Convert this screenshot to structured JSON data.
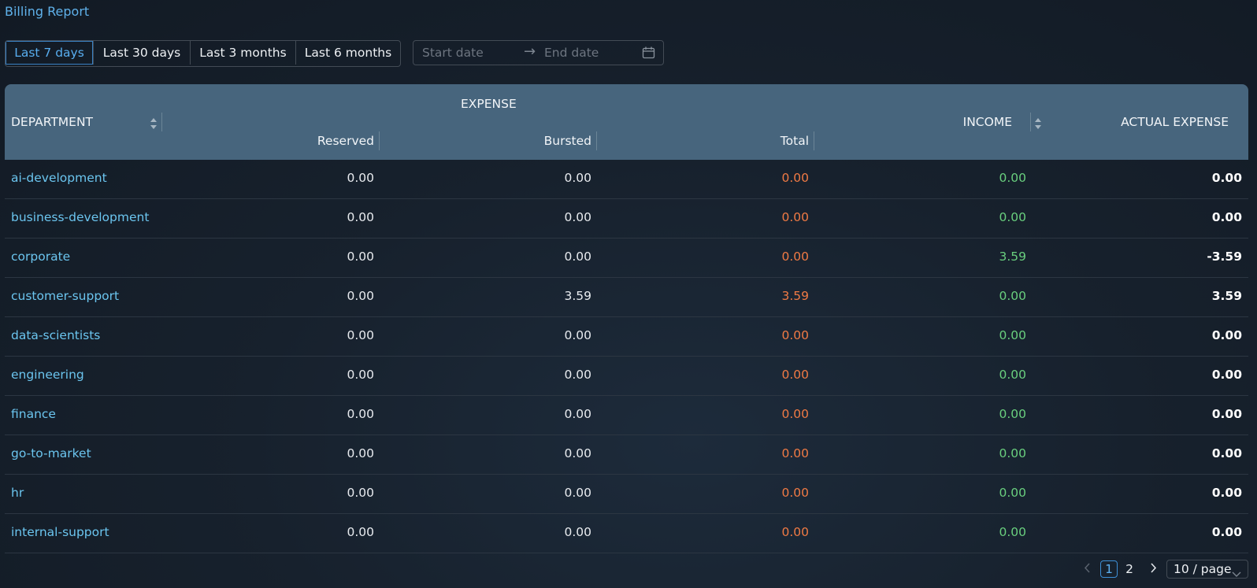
{
  "page": {
    "title": "Billing Report"
  },
  "ranges": [
    {
      "label": "Last 7 days",
      "active": true
    },
    {
      "label": "Last 30 days",
      "active": false
    },
    {
      "label": "Last 3 months",
      "active": false
    },
    {
      "label": "Last 6 months",
      "active": false
    }
  ],
  "date_picker": {
    "start_placeholder": "Start date",
    "end_placeholder": "End date",
    "separator": "→",
    "icon": "calendar-icon"
  },
  "table": {
    "headers": {
      "department": "DEPARTMENT",
      "expense": "EXPENSE",
      "reserved": "Reserved",
      "bursted": "Bursted",
      "total": "Total",
      "income": "INCOME",
      "actual_expense": "ACTUAL EXPENSE"
    },
    "rows": [
      {
        "department": "ai-development",
        "reserved": "0.00",
        "bursted": "0.00",
        "total": "0.00",
        "income": "0.00",
        "actual": "0.00"
      },
      {
        "department": "business-development",
        "reserved": "0.00",
        "bursted": "0.00",
        "total": "0.00",
        "income": "0.00",
        "actual": "0.00"
      },
      {
        "department": "corporate",
        "reserved": "0.00",
        "bursted": "0.00",
        "total": "0.00",
        "income": "3.59",
        "actual": "-3.59"
      },
      {
        "department": "customer-support",
        "reserved": "0.00",
        "bursted": "3.59",
        "total": "3.59",
        "income": "0.00",
        "actual": "3.59"
      },
      {
        "department": "data-scientists",
        "reserved": "0.00",
        "bursted": "0.00",
        "total": "0.00",
        "income": "0.00",
        "actual": "0.00"
      },
      {
        "department": "engineering",
        "reserved": "0.00",
        "bursted": "0.00",
        "total": "0.00",
        "income": "0.00",
        "actual": "0.00"
      },
      {
        "department": "finance",
        "reserved": "0.00",
        "bursted": "0.00",
        "total": "0.00",
        "income": "0.00",
        "actual": "0.00"
      },
      {
        "department": "go-to-market",
        "reserved": "0.00",
        "bursted": "0.00",
        "total": "0.00",
        "income": "0.00",
        "actual": "0.00"
      },
      {
        "department": "hr",
        "reserved": "0.00",
        "bursted": "0.00",
        "total": "0.00",
        "income": "0.00",
        "actual": "0.00"
      },
      {
        "department": "internal-support",
        "reserved": "0.00",
        "bursted": "0.00",
        "total": "0.00",
        "income": "0.00",
        "actual": "0.00"
      }
    ]
  },
  "pagination": {
    "pages": [
      "1",
      "2"
    ],
    "current": "1",
    "page_size": "10 / page"
  },
  "colors": {
    "link": "#6bc5ef",
    "accent": "#58aef0",
    "expense_total": "#f07a44",
    "income": "#69cf7e",
    "header_bg": "#47657d"
  }
}
